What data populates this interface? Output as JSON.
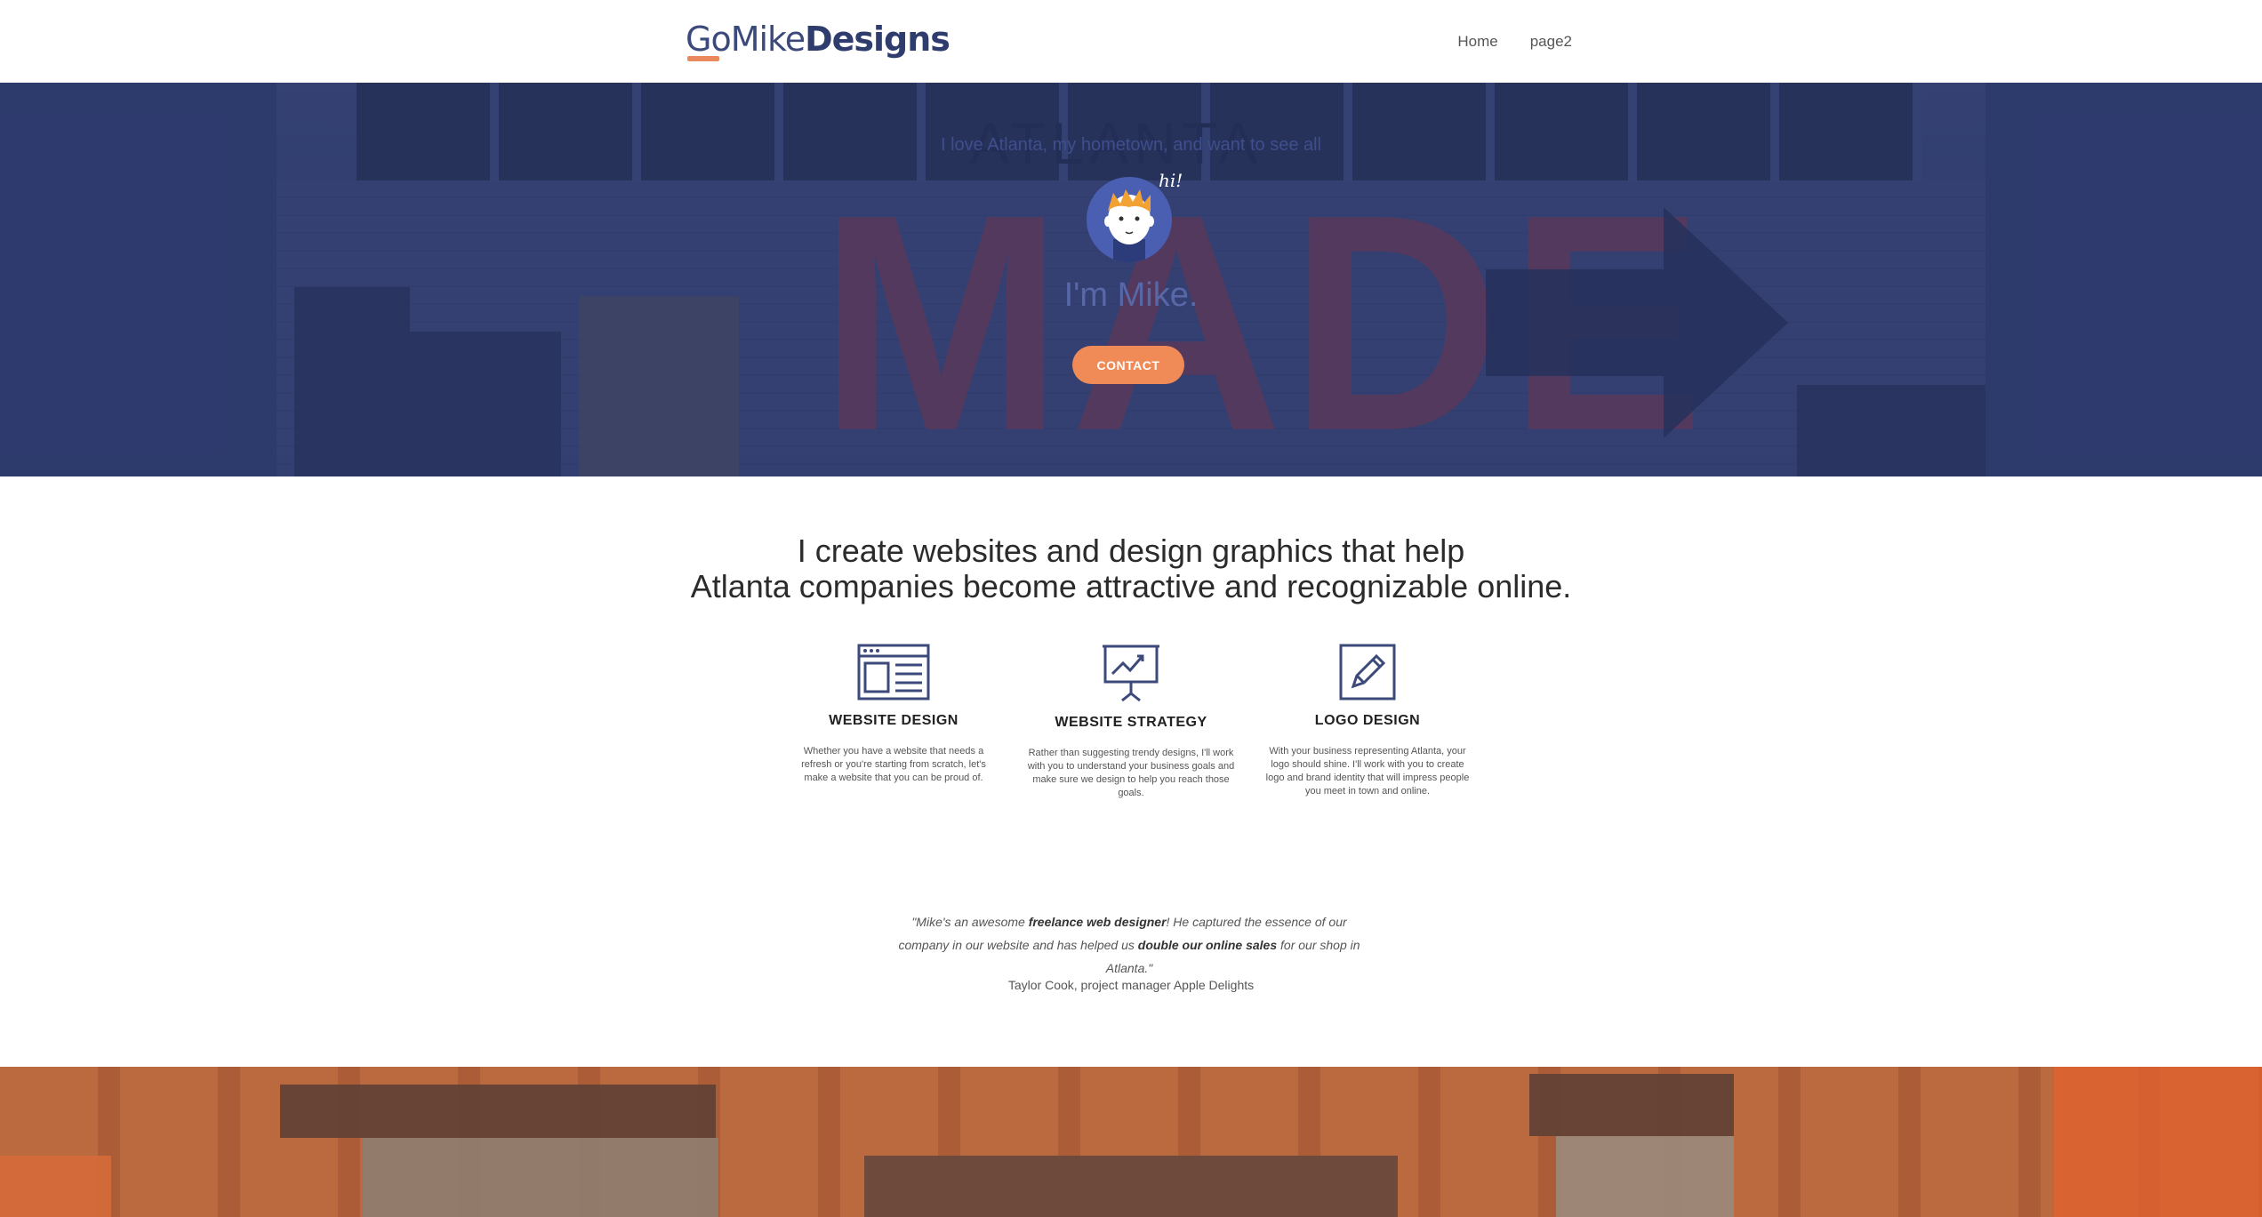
{
  "header": {
    "logo": {
      "part1": "Go",
      "part2": "Mike",
      "part3": "Designs"
    },
    "nav": [
      "Home",
      "page2"
    ]
  },
  "hero": {
    "photo_text": {
      "top": "ATLANTA",
      "main": "MADE"
    },
    "greeting": "hi!",
    "title": "I'm Mike.",
    "button": "CONTACT"
  },
  "intro": {
    "line1": "I create websites and design graphics that help",
    "line2": "Atlanta companies become attractive and recognizable online."
  },
  "services": [
    {
      "icon": "website-layout-icon",
      "title": "WEBSITE DESIGN",
      "description": "Whether you have a website that needs a refresh or you're starting from scratch, let's make a website that you can be proud of."
    },
    {
      "icon": "presentation-chart-icon",
      "title": "WEBSITE STRATEGY",
      "description": "Rather than suggesting trendy designs, I'll work with you to understand your business goals and make sure we design to help you reach those goals."
    },
    {
      "icon": "pencil-icon",
      "title": "LOGO DESIGN",
      "description": "With your business representing Atlanta, your logo should shine. I'll work with you to create logo and brand identity that will impress people you meet in town and online."
    }
  ],
  "testimonial": {
    "part1": "\"Mike's an awesome ",
    "bold1": "freelance web designer",
    "part2": "! He captured the essence of our company in our website and has helped us ",
    "bold2": "double our online sales",
    "part3": " for our shop in Atlanta.\"",
    "author": "Taylor Cook, project manager Apple Delights"
  },
  "bottom": {
    "text": "I love Atlanta, my hometown, and want to see all"
  },
  "colors": {
    "accent": "#f08a57",
    "brand_blue": "#2f3d6e",
    "hero_overlay": "#2f3b6b"
  }
}
